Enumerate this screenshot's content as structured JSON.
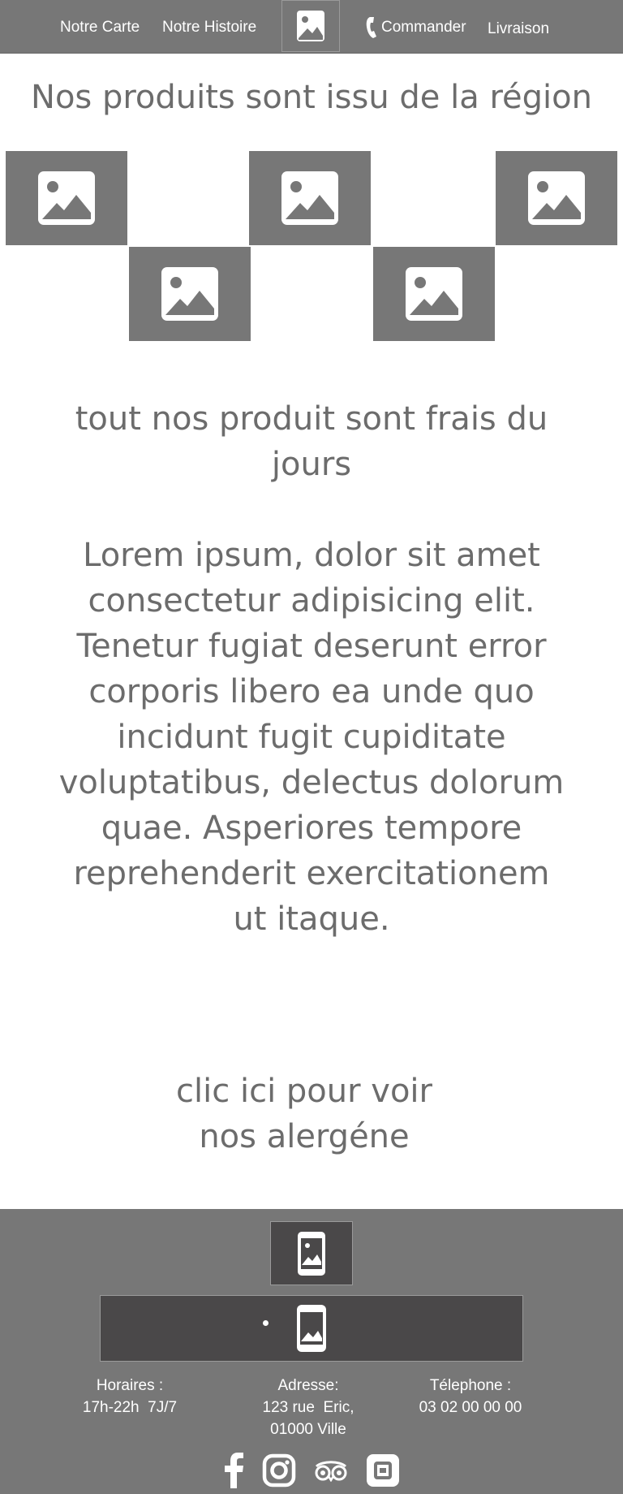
{
  "nav": {
    "items": [
      {
        "label": "Notre Carte"
      },
      {
        "label": "Notre Histoire"
      },
      {
        "label": "Commander"
      },
      {
        "label": "Livraison"
      }
    ],
    "logo_icon": "image-icon"
  },
  "main": {
    "headline": "Nos produits sont issu de la région",
    "gallery_icon": "image-placeholder-icon",
    "subhead": "tout nos produit sont frais du jours",
    "lorem": "Lorem ipsum, dolor sit amet consectetur adipisicing elit. Tenetur fugiat deserunt error corporis libero ea unde quo incidunt fugit cupiditate voluptatibus, delectus dolorum quae. Asperiores tempore reprehenderit exercitationem ut itaque.",
    "allergen_line1": "clic ici pour voir",
    "allergen_line2": "nos alergéne"
  },
  "footer": {
    "hours_label": "Horaires :",
    "hours_value": "17h-22h  7J/7",
    "address_label": "Adresse:",
    "address_line1": "123 rue  Eric,",
    "address_line2": "01000 Ville",
    "phone_label": "Télephone :",
    "phone_value": "03 02 00 00 00",
    "socials": [
      "facebook-icon",
      "instagram-icon",
      "tripadvisor-icon",
      "ubereats-icon"
    ]
  },
  "colors": {
    "bar": "#777777",
    "dark_panel": "#4a4849",
    "text": "#6c6c6c",
    "white": "#ffffff"
  }
}
